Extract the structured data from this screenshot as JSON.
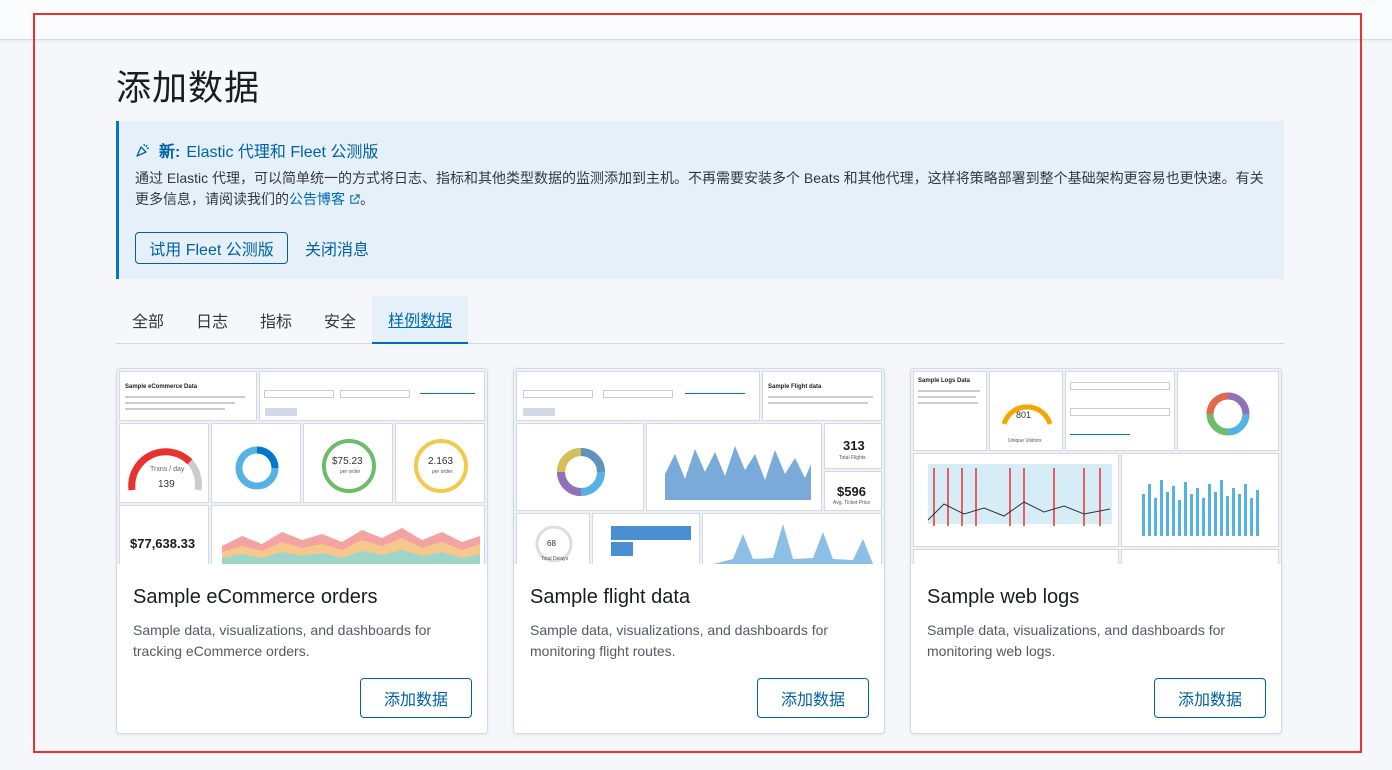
{
  "page": {
    "title": "添加数据"
  },
  "callout": {
    "new_label": "新:",
    "title": "Elastic 代理和 Fleet 公测版",
    "body": "通过 Elastic 代理，可以简单统一的方式将日志、指标和其他类型数据的监测添加到主机。不再需要安装多个 Beats 和其他代理，这样将策略部署到整个基础架构更容易也更快速。有关更多信息，请阅读我们的",
    "link_label": "公告博客",
    "body_end": "。",
    "try_button": "试用 Fleet 公测版",
    "dismiss_button": "关闭消息"
  },
  "tabs": [
    {
      "label": "全部"
    },
    {
      "label": "日志"
    },
    {
      "label": "指标"
    },
    {
      "label": "安全"
    },
    {
      "label": "样例数据",
      "selected": true
    }
  ],
  "cards": [
    {
      "title": "Sample eCommerce orders",
      "description": "Sample data, visualizations, and dashboards for tracking eCommerce orders.",
      "button": "添加数据",
      "thumb": {
        "heading": "Sample eCommerce Data",
        "gauge_label": "Trxns / day",
        "gauge_value": "139",
        "avg_price": "$75.23",
        "avg_price_sub": "per order",
        "avg_qty": "2.163",
        "avg_qty_sub": "per order",
        "revenue": "$77,638.33"
      }
    },
    {
      "title": "Sample flight data",
      "description": "Sample data, visualizations, and dashboards for monitoring flight routes.",
      "button": "添加数据",
      "thumb": {
        "heading": "Sample Flight data",
        "total_flights": "313",
        "total_flights_label": "Total Flights",
        "ticket_price": "$596",
        "ticket_price_label": "Avg. Ticket Price",
        "delays": "68",
        "delays_label": "Total Delays"
      }
    },
    {
      "title": "Sample web logs",
      "description": "Sample data, visualizations, and dashboards for monitoring web logs.",
      "button": "添加数据",
      "thumb": {
        "heading": "Sample Logs Data",
        "gauge_value": "801",
        "gauge_label": "Unique Visitors"
      }
    }
  ],
  "colors": {
    "accent": "#006bb8",
    "callout_bg": "#e6f0f8",
    "highlight_frame": "#e7322d"
  }
}
